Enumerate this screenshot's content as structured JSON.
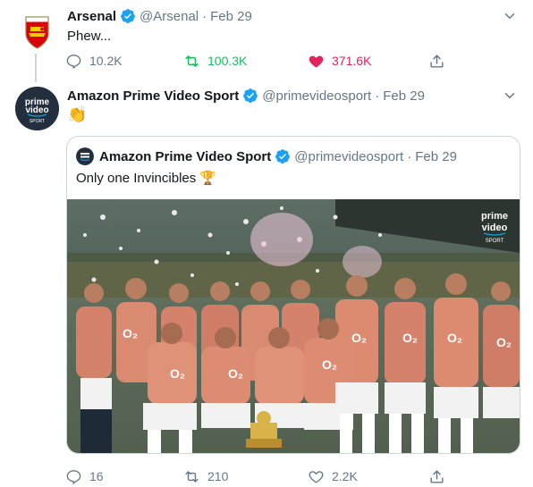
{
  "tweet1": {
    "name": "Arsenal",
    "handle": "@Arsenal",
    "separator": "·",
    "date": "Feb 29",
    "text": "Phew...",
    "replies": "10.2K",
    "retweets": "100.3K",
    "likes": "371.6K",
    "avatar_label": "Arsenal"
  },
  "tweet2": {
    "name": "Amazon Prime Video Sport",
    "handle": "@primevideosport",
    "separator": "·",
    "date": "Feb 29",
    "text": "👏",
    "replies": "16",
    "retweets": "210",
    "likes": "2.2K",
    "avatar_lines": [
      "prime",
      "video",
      "SPORT"
    ]
  },
  "quote": {
    "name": "Amazon Prime Video Sport",
    "handle": "@primevideosport",
    "separator": "·",
    "date": "Feb 29",
    "text": "Only one Invincibles 🏆",
    "media_watermark": [
      "prime",
      "video",
      "SPORT"
    ]
  },
  "colors": {
    "verified": "#1da1f2",
    "retweet_active": "#17bf63",
    "like_active": "#e0245e",
    "muted": "#657786",
    "border": "#ccd6dd"
  }
}
